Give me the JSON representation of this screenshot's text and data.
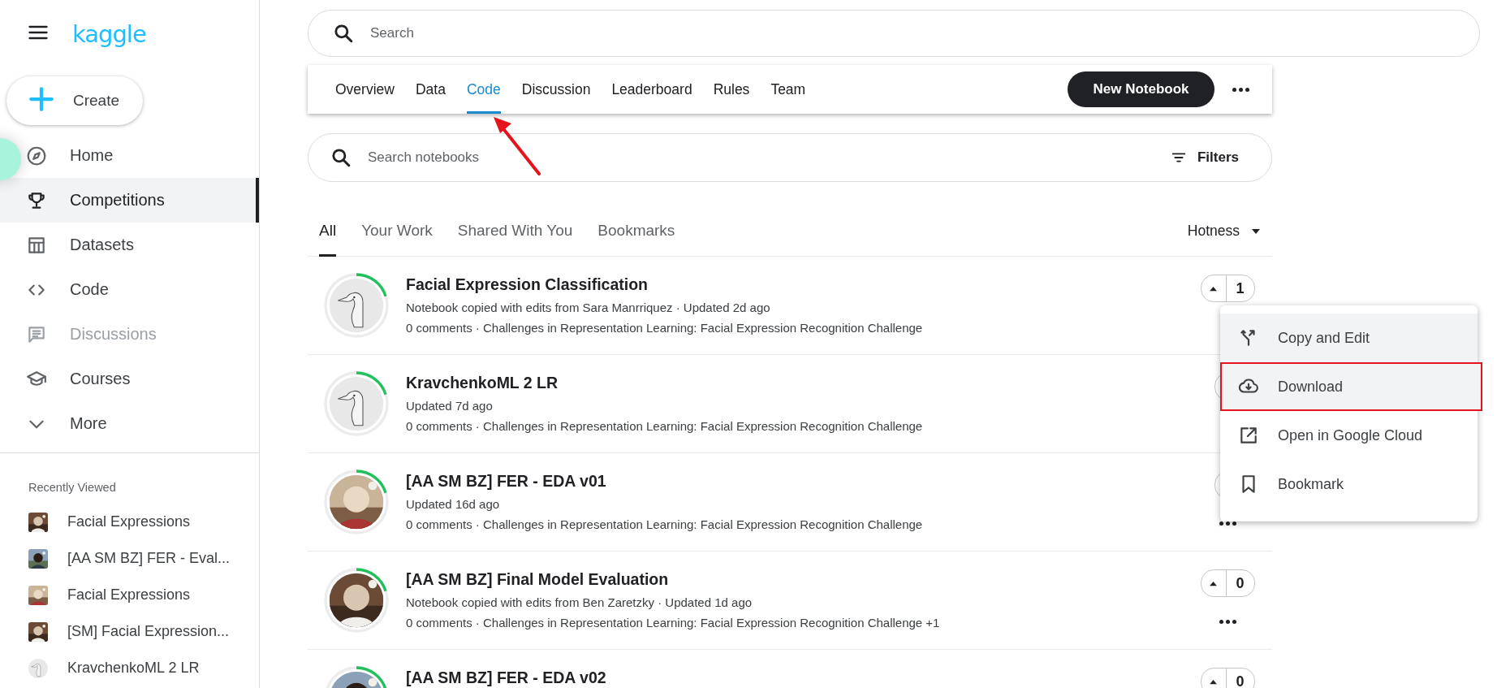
{
  "sidebar": {
    "logo": "kaggle",
    "create": "Create",
    "nav": [
      {
        "label": "Home",
        "kind": "compass",
        "selected": false,
        "disabled": false
      },
      {
        "label": "Competitions",
        "kind": "trophy",
        "selected": true,
        "disabled": false
      },
      {
        "label": "Datasets",
        "kind": "table",
        "selected": false,
        "disabled": false
      },
      {
        "label": "Code",
        "kind": "code",
        "selected": false,
        "disabled": false
      },
      {
        "label": "Discussions",
        "kind": "comment",
        "selected": false,
        "disabled": true
      },
      {
        "label": "Courses",
        "kind": "school",
        "selected": false,
        "disabled": false
      },
      {
        "label": "More",
        "kind": "chevron",
        "selected": false,
        "disabled": false
      }
    ],
    "recent_title": "Recently Viewed",
    "recent": [
      {
        "label": "Facial Expressions",
        "kind": "picture"
      },
      {
        "label": "[AA SM BZ] FER - Eval...",
        "kind": "picture"
      },
      {
        "label": "Facial Expressions",
        "kind": "picture"
      },
      {
        "label": "[SM] Facial Expression...",
        "kind": "picture"
      },
      {
        "label": "KravchenkoML 2 LR",
        "kind": "goose"
      }
    ]
  },
  "search": {
    "placeholder": "Search"
  },
  "tabs": [
    {
      "label": "Overview",
      "selected": false
    },
    {
      "label": "Data",
      "selected": false
    },
    {
      "label": "Code",
      "selected": true
    },
    {
      "label": "Discussion",
      "selected": false
    },
    {
      "label": "Leaderboard",
      "selected": false
    },
    {
      "label": "Rules",
      "selected": false
    },
    {
      "label": "Team",
      "selected": false
    }
  ],
  "new_notebook": "New Notebook",
  "notebook_search": {
    "placeholder": "Search notebooks"
  },
  "filters": "Filters",
  "list_tabs": [
    {
      "label": "All",
      "selected": true
    },
    {
      "label": "Your Work",
      "selected": false
    },
    {
      "label": "Shared With You",
      "selected": false
    },
    {
      "label": "Bookmarks",
      "selected": false
    }
  ],
  "sort": "Hotness",
  "notebooks": [
    {
      "title": "Facial Expression Classification",
      "lines": [
        "Notebook copied with edits from Sara Manrriquez · Updated 2d ago",
        "0 comments · Challenges in Representation Learning: Facial Expression Recognition Challenge"
      ],
      "kind": "goose",
      "votes": "1",
      "more": false
    },
    {
      "title": "KravchenkoML 2 LR",
      "lines": [
        "Updated 7d ago",
        "0 comments · Challenges in Representation Learning: Facial Expression Recognition Challenge"
      ],
      "kind": "goose",
      "more": false
    },
    {
      "title": "[AA SM BZ] FER - EDA v01",
      "lines": [
        "Updated 16d ago",
        "0 comments · Challenges in Representation Learning: Facial Expression Recognition Challenge"
      ],
      "kind": "picture",
      "more": true
    },
    {
      "title": "[AA SM BZ] Final Model Evaluation",
      "lines": [
        "Notebook copied with edits from Ben Zaretzky · Updated 1d ago",
        "0 comments · Challenges in Representation Learning: Facial Expression Recognition Challenge +1"
      ],
      "kind": "picture",
      "votes": "0",
      "more": true
    },
    {
      "title": "[AA SM BZ] FER - EDA v02",
      "kind": "picture",
      "votes": "0"
    }
  ],
  "menu": [
    {
      "label": "Copy and Edit",
      "kind": "fork",
      "highlighted": true,
      "annotated": false
    },
    {
      "label": "Download",
      "kind": "cloud",
      "highlighted": true,
      "annotated": true
    },
    {
      "label": "Open in Google Cloud",
      "kind": "external",
      "highlighted": false,
      "annotated": false
    },
    {
      "label": "Bookmark",
      "kind": "bookmark",
      "highlighted": false,
      "annotated": false
    }
  ]
}
